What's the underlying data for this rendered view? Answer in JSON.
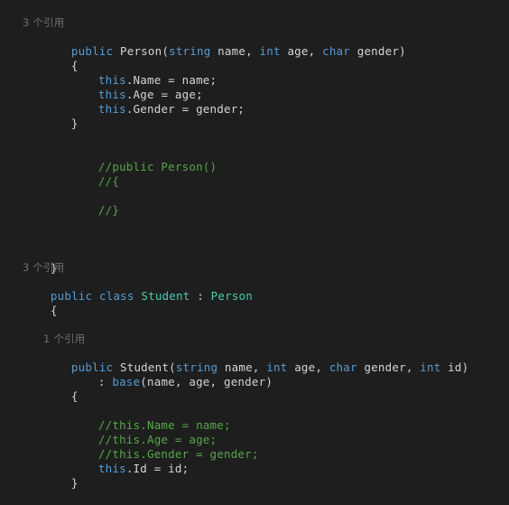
{
  "editor": {
    "language": "csharp",
    "theme": "dark-plus",
    "background_color": "#1e1e1e",
    "default_text_color": "#d4d4d4",
    "colors": {
      "keyword": "#569cd6",
      "type": "#4ec9b0",
      "comment": "#57a64a",
      "plain": "#d4d4d4",
      "codelens": "#6e6e6e"
    }
  },
  "codelens": {
    "person_ctor": "3 个引用",
    "student_class": "3 个引用",
    "student_ctor": "1 个引用"
  },
  "code": {
    "person_ctor_signature": {
      "kw_public": "public",
      "name": "Person",
      "paren_open": "(",
      "p1_type": "string",
      "p1_name": " name, ",
      "p2_type": "int",
      "p2_name": " age, ",
      "p3_type": "char",
      "p3_name": " gender)"
    },
    "brace_open": "{",
    "brace_close": "}",
    "assign_name": {
      "kw": "this",
      "rest": ".Name = name;"
    },
    "assign_age": {
      "kw": "this",
      "rest": ".Age = age;"
    },
    "assign_gender": {
      "kw": "this",
      "rest": ".Gender = gender;"
    },
    "comment_ctor": "//public Person()",
    "comment_brace_open": "//{",
    "comment_brace_close": "//}",
    "class_decl": {
      "kw_public": "public",
      "kw_class": "class",
      "name": "Student",
      "colon": " : ",
      "base": "Person"
    },
    "student_ctor_signature": {
      "kw_public": "public",
      "name": "Student",
      "paren_open": "(",
      "p1_type": "string",
      "p1_name": " name, ",
      "p2_type": "int",
      "p2_name": " age, ",
      "p3_type": "char",
      "p3_name": " gender, ",
      "p4_type": "int",
      "p4_name": " id)"
    },
    "base_call": {
      "colon": ": ",
      "kw_base": "base",
      "args": "(name, age, gender)"
    },
    "comment_assign_name": "//this.Name = name;",
    "comment_assign_age": "//this.Age = age;",
    "comment_assign_gender": "//this.Gender = gender;",
    "assign_id": {
      "kw": "this",
      "rest": ".Id = id;"
    }
  }
}
